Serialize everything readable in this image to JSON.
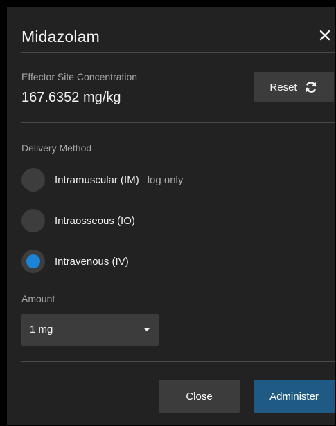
{
  "dialog": {
    "title": "Midazolam"
  },
  "effector_site": {
    "label": "Effector Site Concentration",
    "value": "167.6352 mg/kg"
  },
  "reset_button": {
    "label": "Reset"
  },
  "delivery": {
    "label": "Delivery Method",
    "selected_index": 2,
    "options": [
      {
        "label": "Intramuscular (IM)",
        "note": "log only",
        "checked": false
      },
      {
        "label": "Intraosseous (IO)",
        "note": "",
        "checked": false
      },
      {
        "label": "Intravenous (IV)",
        "note": "",
        "checked": true
      }
    ]
  },
  "amount": {
    "label": "Amount",
    "value": "1 mg"
  },
  "actions": {
    "close_label": "Close",
    "administer_label": "Administer"
  },
  "colors": {
    "background": "#222222",
    "accent_radio": "#1a84d8",
    "primary_button": "#1f5a85",
    "secondary_button": "#3c3c3c"
  },
  "icons": {
    "close": "close-icon",
    "reset": "refresh-icon",
    "dropdown": "chevron-down-icon"
  }
}
